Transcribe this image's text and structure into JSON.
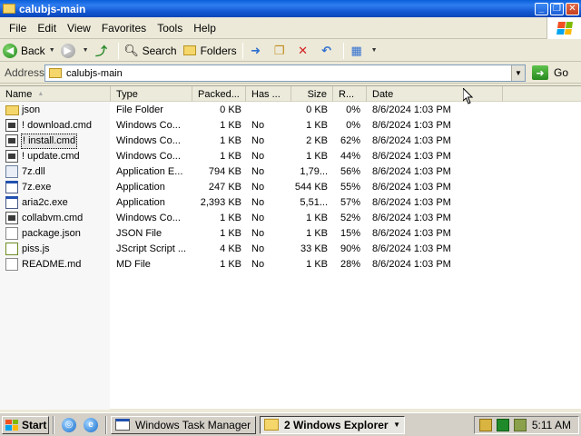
{
  "window": {
    "title": "calubjs-main",
    "buttons": {
      "minimize": "_",
      "maximize": "❐",
      "close": "✕"
    }
  },
  "menu": [
    "File",
    "Edit",
    "View",
    "Favorites",
    "Tools",
    "Help"
  ],
  "toolbar": {
    "back": "Back",
    "search": "Search",
    "folders": "Folders"
  },
  "address": {
    "label": "Address",
    "value": "calubjs-main",
    "go": "Go"
  },
  "columns": [
    "Name",
    "Type",
    "Packed...",
    "Has ...",
    "Size",
    "R...",
    "Date"
  ],
  "files": [
    {
      "name": "json",
      "type": "File Folder",
      "packed": "0 KB",
      "has": "",
      "size": "0 KB",
      "ratio": "0%",
      "date": "8/6/2024 1:03 PM",
      "icon": "folder-icon"
    },
    {
      "name": "! download.cmd",
      "type": "Windows Co...",
      "packed": "1 KB",
      "has": "No",
      "size": "1 KB",
      "ratio": "0%",
      "date": "8/6/2024 1:03 PM",
      "icon": "cmd-icon"
    },
    {
      "name": "! install.cmd",
      "type": "Windows Co...",
      "packed": "1 KB",
      "has": "No",
      "size": "2 KB",
      "ratio": "62%",
      "date": "8/6/2024 1:03 PM",
      "icon": "cmd-icon",
      "selected": true
    },
    {
      "name": "! update.cmd",
      "type": "Windows Co...",
      "packed": "1 KB",
      "has": "No",
      "size": "1 KB",
      "ratio": "44%",
      "date": "8/6/2024 1:03 PM",
      "icon": "cmd-icon"
    },
    {
      "name": "7z.dll",
      "type": "Application E...",
      "packed": "794 KB",
      "has": "No",
      "size": "1,79...",
      "ratio": "56%",
      "date": "8/6/2024 1:03 PM",
      "icon": "dll-icon"
    },
    {
      "name": "7z.exe",
      "type": "Application",
      "packed": "247 KB",
      "has": "No",
      "size": "544 KB",
      "ratio": "55%",
      "date": "8/6/2024 1:03 PM",
      "icon": "exe-icon"
    },
    {
      "name": "aria2c.exe",
      "type": "Application",
      "packed": "2,393 KB",
      "has": "No",
      "size": "5,51...",
      "ratio": "57%",
      "date": "8/6/2024 1:03 PM",
      "icon": "exe-icon"
    },
    {
      "name": "collabvm.cmd",
      "type": "Windows Co...",
      "packed": "1 KB",
      "has": "No",
      "size": "1 KB",
      "ratio": "52%",
      "date": "8/6/2024 1:03 PM",
      "icon": "cmd-icon"
    },
    {
      "name": "package.json",
      "type": "JSON File",
      "packed": "1 KB",
      "has": "No",
      "size": "1 KB",
      "ratio": "15%",
      "date": "8/6/2024 1:03 PM",
      "icon": "doc-icon"
    },
    {
      "name": "piss.js",
      "type": "JScript Script ...",
      "packed": "4 KB",
      "has": "No",
      "size": "33 KB",
      "ratio": "90%",
      "date": "8/6/2024 1:03 PM",
      "icon": "js-icon"
    },
    {
      "name": "README.md",
      "type": "MD File",
      "packed": "1 KB",
      "has": "No",
      "size": "1 KB",
      "ratio": "28%",
      "date": "8/6/2024 1:03 PM",
      "icon": "doc-icon"
    }
  ],
  "taskbar": {
    "start": "Start",
    "tasks": [
      "Windows Task Manager",
      "2 Windows Explorer"
    ],
    "clock": "5:11 AM"
  }
}
